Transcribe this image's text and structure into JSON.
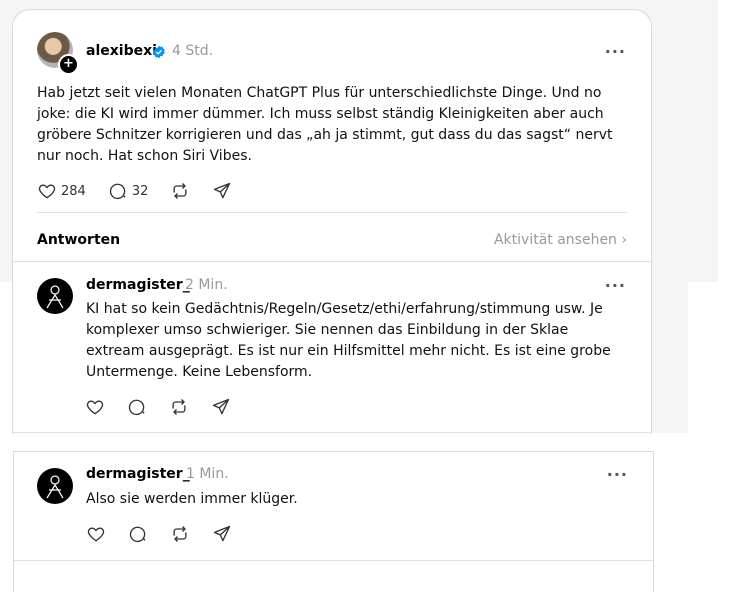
{
  "post": {
    "username": "alexibexi",
    "time": "4 Std.",
    "text": "Hab jetzt seit vielen Monaten ChatGPT Plus für unterschiedlichste Dinge. Und no joke: die KI wird immer dümmer. Ich muss selbst ständig Kleinigkeiten aber auch gröbere Schnitzer korrigieren und das „ah ja stimmt, gut dass du das sagst“ nervt nur noch. Hat schon Siri Vibes.",
    "likes": "284",
    "replies": "32"
  },
  "replies_header": {
    "label": "Antworten",
    "activity": "Aktivität ansehen"
  },
  "reply1": {
    "username": "dermagister_",
    "time": "2 Min.",
    "text": "KI hat so kein Gedächtnis/Regeln/Gesetz/ethi/erfahrung/stimmung usw. Je komplexer umso schwieriger. Sie nennen das Einbildung in der Sklae extream ausgeprägt. Es ist nur ein Hilfsmittel mehr nicht. Es ist eine grobe Untermenge. Keine Lebensform."
  },
  "reply2": {
    "username": "dermagister_",
    "time": "1 Min.",
    "text": "Also sie werden immer klüger."
  },
  "colors": {
    "verified": "#0095f6",
    "muted": "#999999"
  }
}
